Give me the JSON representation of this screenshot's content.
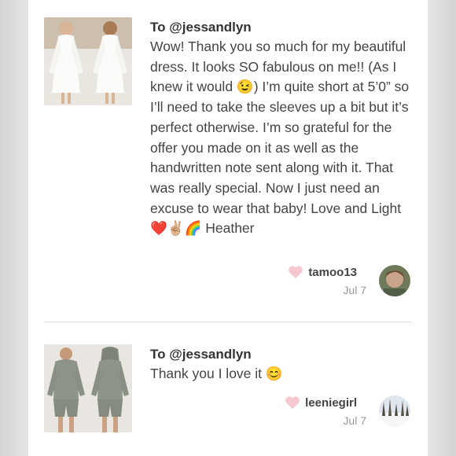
{
  "reviews": [
    {
      "to": "To @jessandlyn",
      "body": "Wow! Thank you so much for my beautiful dress. It looks SO fabulous on me!! (As I knew it would 😉) I’m quite short at 5’0” so I’ll need to take the sleeves up a bit but it’s perfect otherwise. I’m so grateful for the offer you made on it as well as the handwritten note sent along with it. That was really special. Now I just need an excuse to wear that baby! Love and Light ❤️✌🏼🌈 Heather",
      "author": "tamoo13",
      "date": "Jul 7"
    },
    {
      "to": "To @jessandlyn",
      "body": "Thank you I love it 😊",
      "author": "leeniegirl",
      "date": "Jul 7"
    }
  ],
  "icons": {
    "like": "heart-icon"
  },
  "colors": {
    "heart": "#f6c7cf",
    "divider": "#e0e0e0"
  }
}
